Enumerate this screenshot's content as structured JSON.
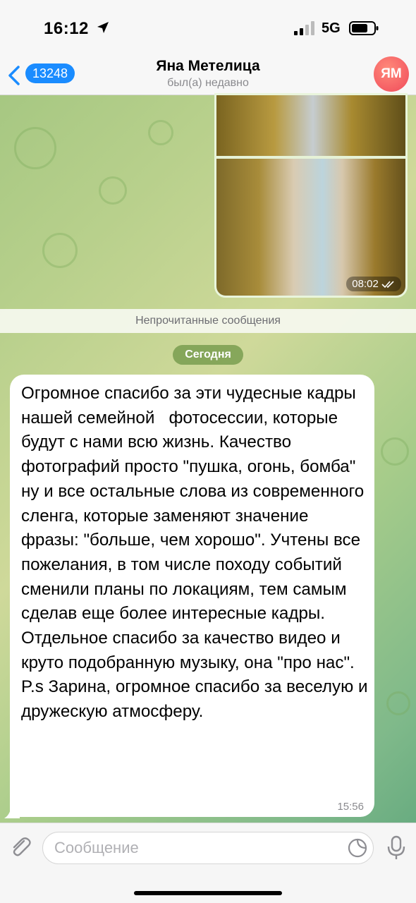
{
  "status_bar": {
    "time": "16:12",
    "network": "5G"
  },
  "header": {
    "back_count": "13248",
    "title": "Яна Метелица",
    "subtitle": "был(а) недавно",
    "avatar_initials": "ЯМ",
    "avatar_color": "#f04a5a"
  },
  "photo_message": {
    "time": "08:02"
  },
  "unread_divider": "Непрочитанные сообщения",
  "date_label": "Сегодня",
  "incoming_message": {
    "text": "Огромное спасибо за эти чудесные кадры нашей семейной   фотосессии, которые будут с нами всю жизнь. Качество фотографий просто \"пушка, огонь, бомба\" ну и все остальные слова из современного сленга, которые заменяют значение фразы: \"больше, чем хорошо\". Учтены все пожелания, в том числе походу событий сменили планы по локациям, тем самым сделав еще более интересные кадры.\nОтдельное спасибо за качество видео и круто подобранную музыку, она \"про нас\".\nP.s Зарина, огромное спасибо за веселую и дружескую атмосферу.",
    "time": "15:56"
  },
  "composer": {
    "placeholder": "Сообщение"
  },
  "colors": {
    "accent": "#1a8cff",
    "bubble": "#ffffff",
    "wallpaper": "#a7cc8a"
  }
}
